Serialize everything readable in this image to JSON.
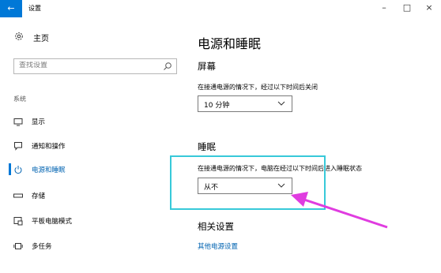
{
  "window": {
    "title": "设置",
    "back_icon": "back-arrow-icon",
    "minimize": "–",
    "maximize": "□",
    "close": "×"
  },
  "sidebar": {
    "home_label": "主页",
    "search_placeholder": "查找设置",
    "section_label": "系统",
    "items": [
      {
        "label": "显示",
        "icon": "display-icon",
        "active": false
      },
      {
        "label": "通知和操作",
        "icon": "notification-icon",
        "active": false
      },
      {
        "label": "电源和睡眠",
        "icon": "power-icon",
        "active": true
      },
      {
        "label": "存储",
        "icon": "storage-icon",
        "active": false
      },
      {
        "label": "平板电脑模式",
        "icon": "tablet-mode-icon",
        "active": false
      },
      {
        "label": "多任务",
        "icon": "multitask-icon",
        "active": false
      }
    ]
  },
  "main": {
    "title": "电源和睡眠",
    "screen": {
      "heading": "屏幕",
      "description": "在接通电源的情况下，经过以下时间后关闭",
      "value": "10 分钟"
    },
    "sleep": {
      "heading": "睡眠",
      "description": "在接通电源的情况下，电脑在经过以下时间后进入睡眠状态",
      "value": "从不"
    },
    "related": {
      "heading": "相关设置",
      "link": "其他电源设置"
    }
  },
  "colors": {
    "accent": "#0078d7",
    "link": "#0063b1",
    "highlight_box": "#38c9d9",
    "arrow": "#e03ce0"
  }
}
